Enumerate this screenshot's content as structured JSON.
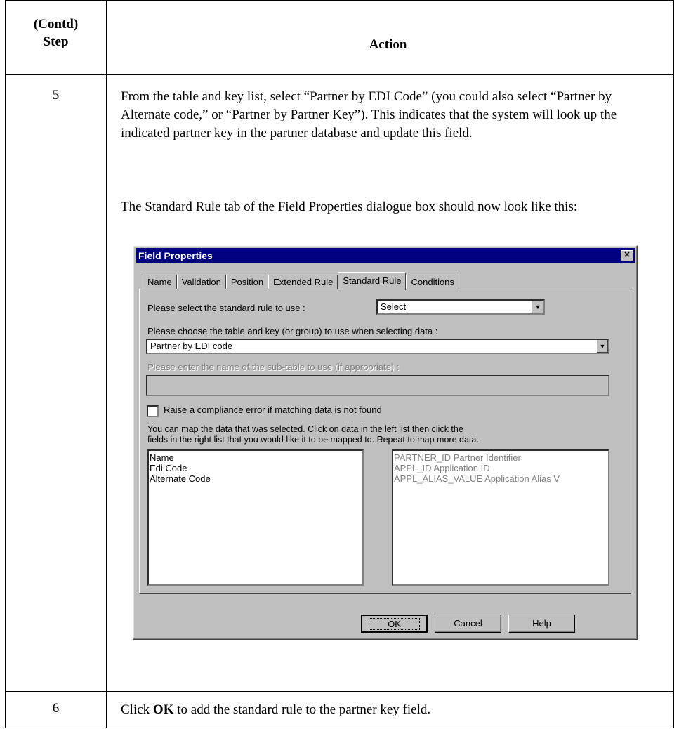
{
  "header": {
    "step_line1": "(Contd)",
    "step_line2": "Step",
    "action": "Action"
  },
  "rows": [
    {
      "step": "5",
      "para1": "From the table and key list, select “Partner by EDI Code” (you could also select “Partner by Alternate code,” or “Partner by Partner Key”). This indicates that the system will look up the indicated partner key in the partner database and update this field.",
      "para2": "The Standard Rule tab of the Field Properties dialogue box should now look like this:"
    },
    {
      "step": "6",
      "text_before": "Click ",
      "text_bold": "OK",
      "text_after": " to add the standard rule to the partner key field."
    }
  ],
  "dialog": {
    "title": "Field Properties",
    "close_icon": "close-x-icon",
    "tabs": [
      "Name",
      "Validation",
      "Position",
      "Extended Rule",
      "Standard Rule",
      "Conditions"
    ],
    "active_tab": "Standard Rule",
    "rule_label": "Please select the standard rule to use :",
    "rule_value": "Select",
    "table_label": "Please choose the table and key (or group) to use when selecting data :",
    "table_value": "Partner by EDI code",
    "subtable_label": "Please enter the name of the sub-table to use (if appropriate) :",
    "subtable_value": "",
    "checkbox_label": "Raise a compliance error if matching data is not found",
    "checkbox_checked": false,
    "map_hint_line1": "You can map the data that was selected. Click on data in the left list then click the",
    "map_hint_line2": "fields in the right list that you would like it to be mapped to. Repeat to map more data.",
    "left_list": [
      "Name",
      "Edi Code",
      "Alternate Code"
    ],
    "right_list": [
      "PARTNER_ID Partner Identifier",
      "APPL_ID Application ID",
      "APPL_ALIAS_VALUE Application Alias V"
    ],
    "buttons": {
      "ok": "OK",
      "cancel": "Cancel",
      "help": "Help"
    }
  }
}
